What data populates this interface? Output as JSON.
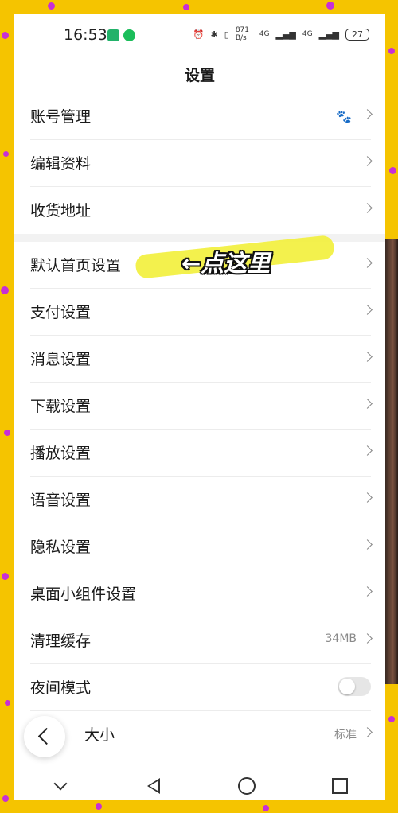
{
  "status": {
    "time": "16:53",
    "net_speed": "871 B/s",
    "signal1": "4G",
    "signal2": "4G",
    "battery": "27"
  },
  "page": {
    "title": "设置"
  },
  "settings": [
    {
      "label": "账号管理",
      "trailing": "paw-icon"
    },
    {
      "label": "编辑资料"
    },
    {
      "label": "收货地址"
    },
    {
      "label": "默认首页设置"
    },
    {
      "label": "支付设置"
    },
    {
      "label": "消息设置"
    },
    {
      "label": "下载设置"
    },
    {
      "label": "播放设置"
    },
    {
      "label": "语音设置"
    },
    {
      "label": "隐私设置"
    },
    {
      "label": "桌面小组件设置"
    },
    {
      "label": "清理缓存",
      "value": "34MB"
    },
    {
      "label": "夜间模式",
      "toggle": false
    },
    {
      "label": "大小",
      "value": "标准"
    }
  ],
  "annotation": {
    "text": "←点这里"
  },
  "colors": {
    "background": "#f5c400",
    "dots": "#c72fd6",
    "highlight": "#f2ef3a"
  }
}
